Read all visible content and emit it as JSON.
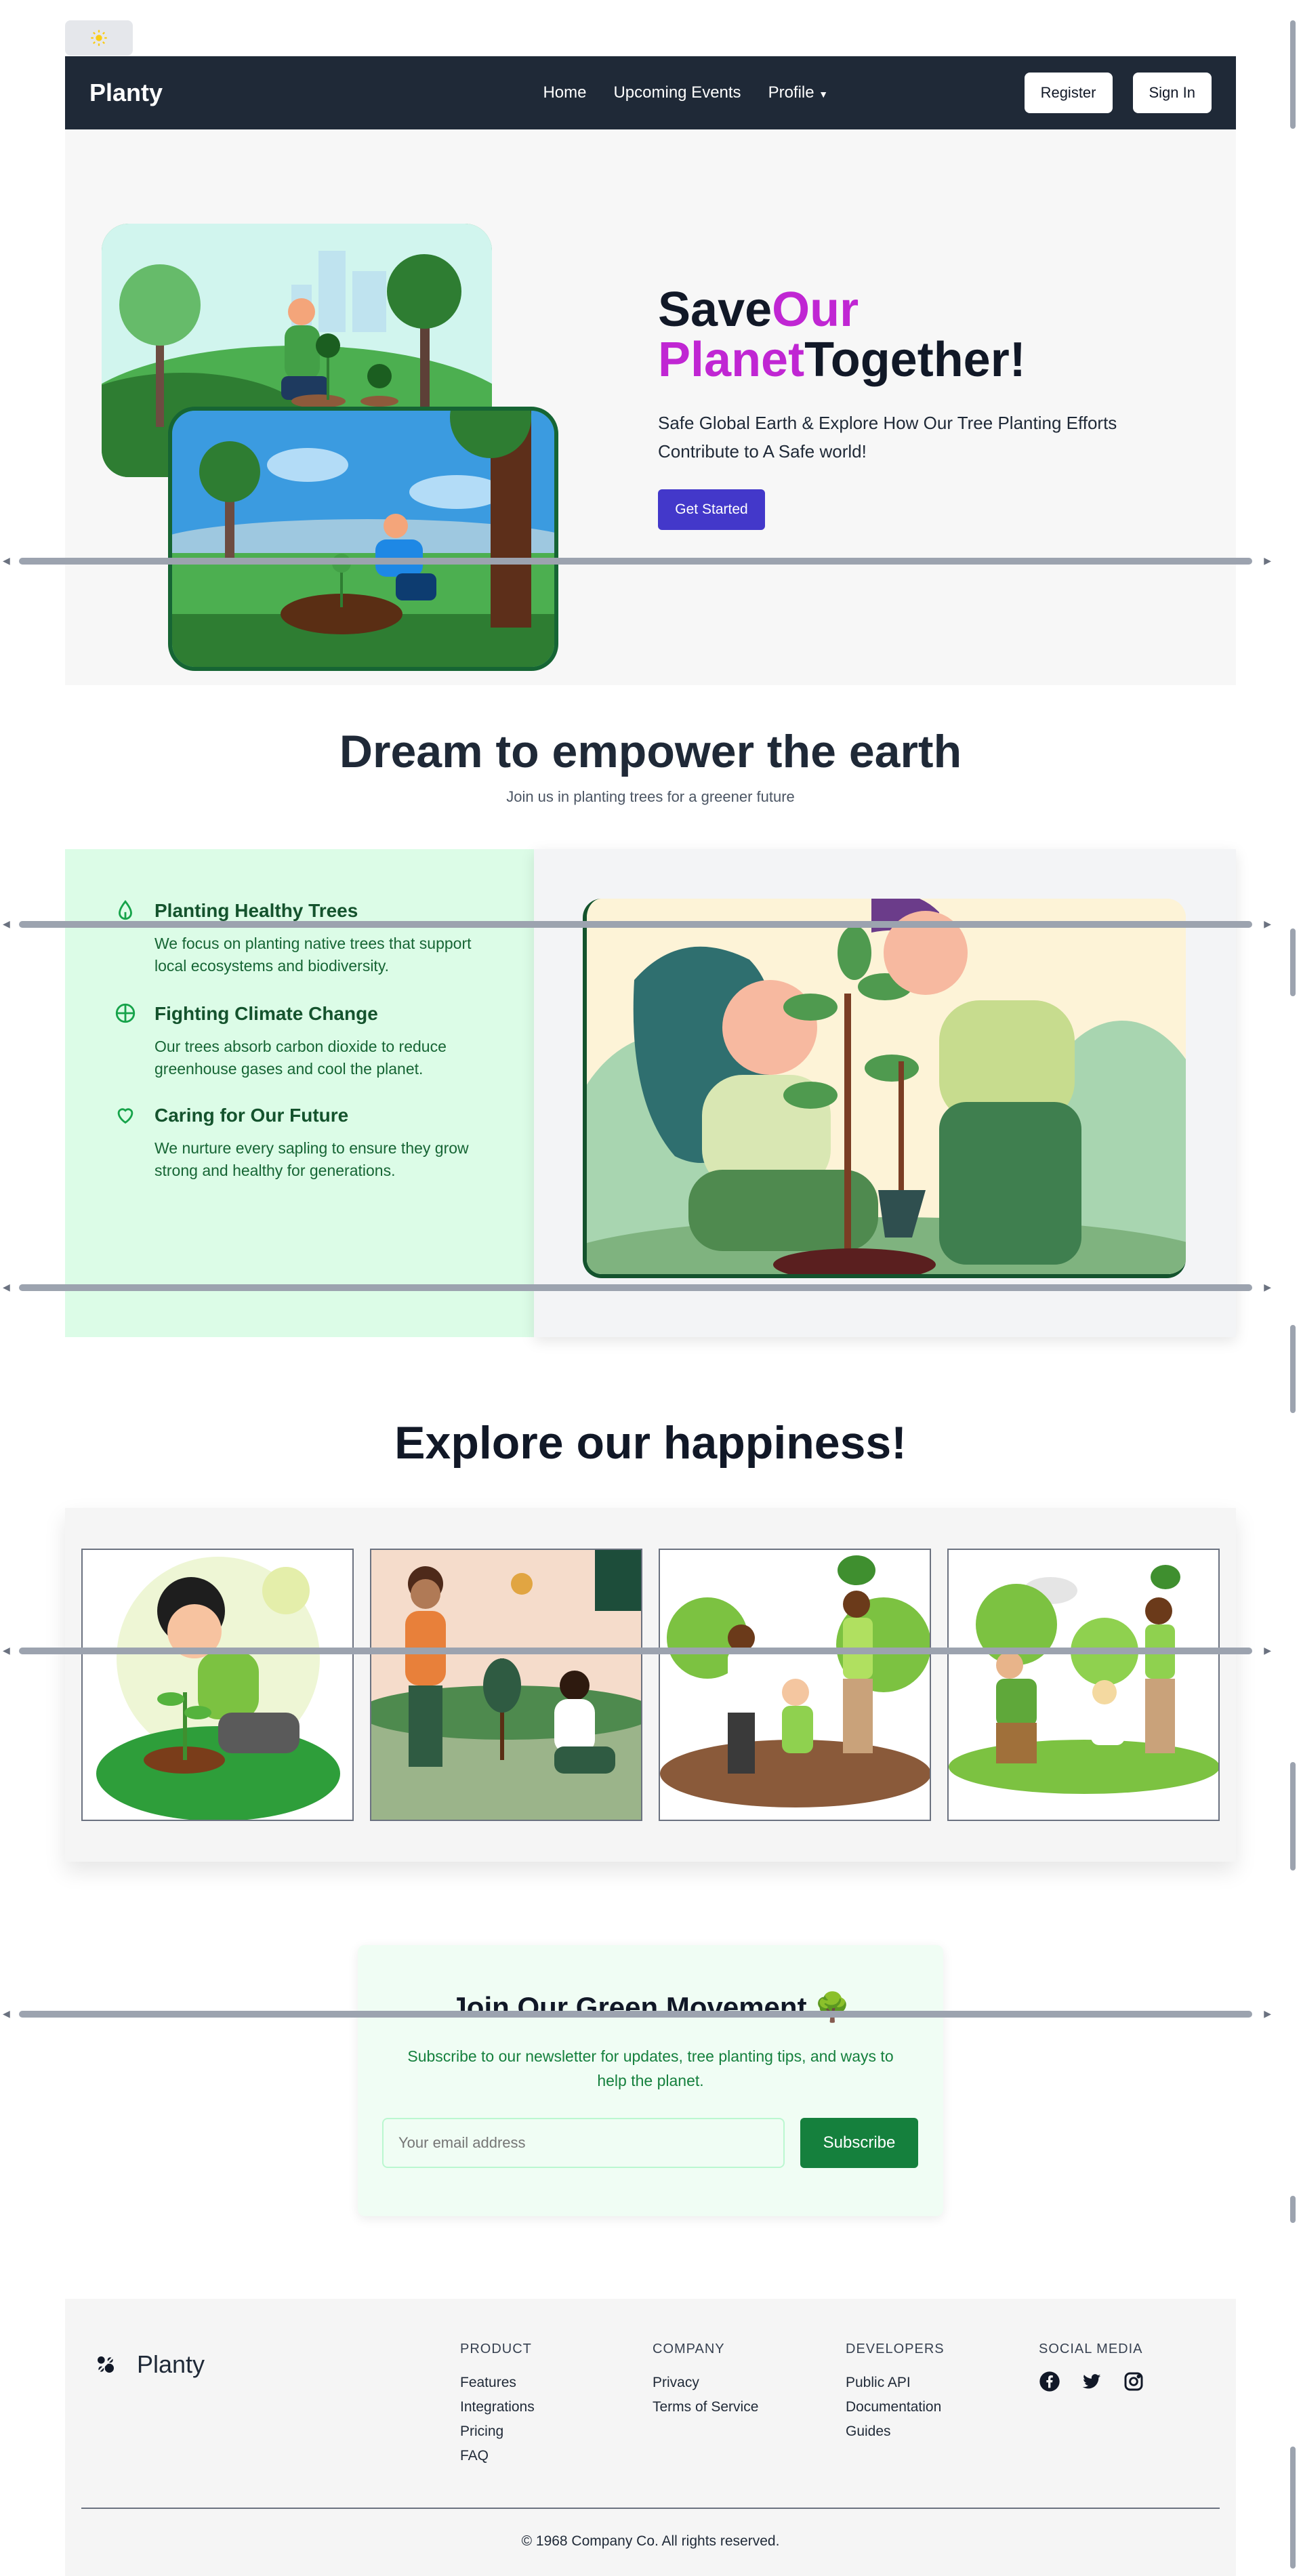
{
  "navbar": {
    "brand": "Planty",
    "links": [
      "Home",
      "Upcoming Events",
      "Profile"
    ],
    "register_label": "Register",
    "signin_label": "Sign In"
  },
  "hero": {
    "title_save": "Save",
    "title_our": "Our",
    "title_planet": "Planet",
    "title_together": "Together!",
    "subtitle": "Safe Global Earth & Explore How Our Tree Planting Efforts Contribute to A Safe world!",
    "cta_label": "Get Started"
  },
  "mission": {
    "title": "Dream to empower the earth",
    "subtitle": "Join us in planting trees for a greener future",
    "features": [
      {
        "title": "Planting Healthy Trees",
        "text": "We focus on planting native trees that support local ecosystems and biodiversity.",
        "icon": "leaf-icon"
      },
      {
        "title": "Fighting Climate Change",
        "text": "Our trees absorb carbon dioxide to reduce greenhouse gases and cool the planet.",
        "icon": "globe-icon"
      },
      {
        "title": "Caring for Our Future",
        "text": "We nurture every sapling to ensure they grow strong and healthy for generations.",
        "icon": "heart-icon"
      }
    ]
  },
  "gallery": {
    "title": "Explore our happiness!"
  },
  "newsletter": {
    "title": "Join Our Green Movement 🌳",
    "text": "Subscribe to our newsletter for updates, tree planting tips, and ways to help the planet.",
    "placeholder": "Your email address",
    "button_label": "Subscribe"
  },
  "footer": {
    "brand": "Planty",
    "columns": [
      {
        "heading": "PRODUCT",
        "links": [
          "Features",
          "Integrations",
          "Pricing",
          "FAQ"
        ]
      },
      {
        "heading": "COMPANY",
        "links": [
          "Privacy",
          "Terms of Service"
        ]
      },
      {
        "heading": "DEVELOPERS",
        "links": [
          "Public API",
          "Documentation",
          "Guides"
        ]
      }
    ],
    "social_heading": "SOCIAL MEDIA",
    "social_icons": [
      "facebook-icon",
      "twitter-icon",
      "instagram-icon"
    ],
    "copyright": "© 1968 Company Co. All rights reserved."
  },
  "theme": {
    "accent": "#c026d3",
    "primary_button": "#4338ca",
    "green": "#15803d",
    "navbar_bg": "#1f2937"
  }
}
